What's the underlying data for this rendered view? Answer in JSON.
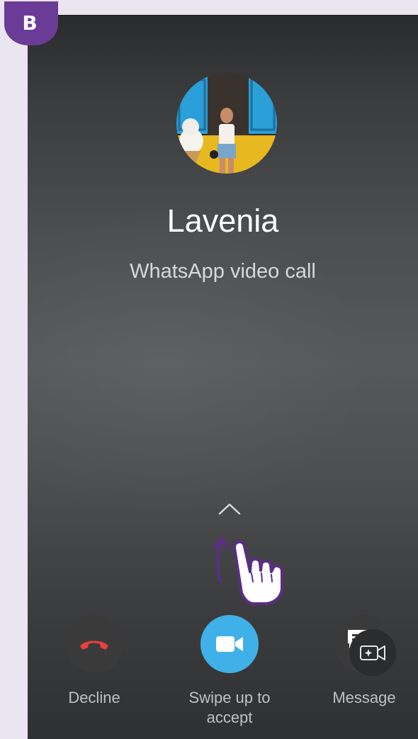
{
  "badge": {
    "letter": "B"
  },
  "caller": {
    "name": "Lavenia",
    "call_type": "WhatsApp video call"
  },
  "actions": {
    "decline_label": "Decline",
    "accept_label": "Swipe up to accept",
    "message_label": "Message"
  },
  "icons": {
    "decline": "phone-hangup-icon",
    "accept": "video-camera-icon",
    "message": "message-icon",
    "swipe_hint": "chevron-up-icon",
    "gesture": "swipe-hand-icon",
    "overlay": "video-sparkle-icon"
  },
  "colors": {
    "badge": "#6a3c97",
    "decline_icon": "#e8403a",
    "accept_button": "#40b0e8",
    "gesture_arrow": "#5b2d86"
  }
}
